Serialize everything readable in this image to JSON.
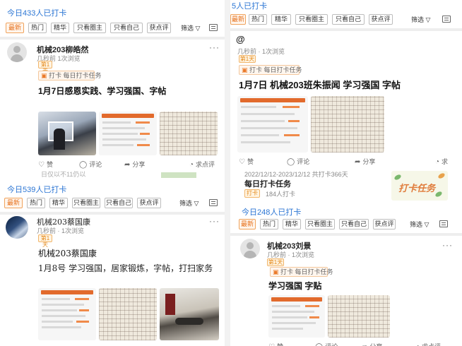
{
  "filter_tags": [
    "最新",
    "热门",
    "精华",
    "只看圈主",
    "只看自己",
    "获点评"
  ],
  "filter_label": "筛选",
  "actions": {
    "like": "赞",
    "comment": "评论",
    "share": "分享",
    "ask": "求点评",
    "ask_short": "求"
  },
  "task_tag": "打卡",
  "task_name": "每日打卡任务",
  "left_top": {
    "count": "今日433人已打卡",
    "post": {
      "user": "机械203柳皓然",
      "time": "几秒前",
      "views": "1次浏览",
      "level": "第1天",
      "title": "1月7日感恩实践、学习强国、字帖",
      "thumbs": [
        "photo-window",
        "phone-screenshot",
        "handwriting"
      ]
    },
    "cutoff_text": "日仅以不11仍以"
  },
  "left_bottom": {
    "count": "今日539人已打卡",
    "post": {
      "user": "机械203蔡国康",
      "time": "几秒前",
      "views": "1次浏览",
      "level": "第1天",
      "title": "机械203蔡国康",
      "body": "1月8号 学习强国，居家锻炼，字帖，打扫家务",
      "thumbs": [
        "phone-screenshot",
        "handwriting",
        "photo-exercise"
      ]
    }
  },
  "right_top": {
    "count": "5人已打卡",
    "post": {
      "user": "@",
      "time": "几秒前",
      "views": "1次浏览",
      "level": "第1天",
      "title": "1月7日 机械203班朱振闻 学习强国 字帖",
      "thumbs": [
        "phone-screenshot",
        "handwriting"
      ]
    },
    "task_card": {
      "dates": "2022/12/12-2023/12/12",
      "days": "共打卡366天",
      "name": "每日打卡任务",
      "tag": "打卡",
      "count": "184人打卡",
      "banner": "打卡任务"
    }
  },
  "right_bottom": {
    "count": "今日248人已打卡",
    "post": {
      "user": "机械203刘景",
      "time": "几秒前",
      "views": "1次浏览",
      "level": "第1天",
      "title": "学习强国 字贴",
      "thumbs": [
        "phone-screenshot",
        "handwriting"
      ]
    }
  },
  "colors": {
    "accent": "#e6711c",
    "count_blue": "#2c76d4",
    "level_orange": "#e48a1c"
  }
}
